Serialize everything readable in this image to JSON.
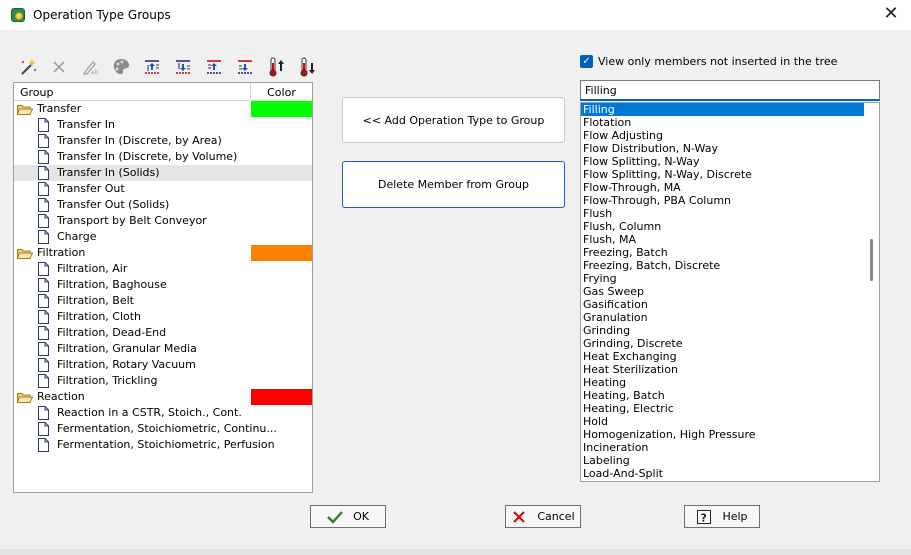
{
  "window": {
    "title": "Operation Type Groups",
    "close_glyph": "✕"
  },
  "toolbar": {
    "icons": [
      "magic-wand-icon",
      "delete-x-icon",
      "rename-pen-icon",
      "palette-icon",
      "move-up-icon",
      "move-down-icon",
      "move-up-alt-icon",
      "move-down-alt-icon",
      "thermo-up-icon",
      "thermo-down-icon"
    ]
  },
  "tree": {
    "header_group": "Group",
    "header_color": "Color",
    "groups": [
      {
        "label": "Transfer",
        "color": "#00ff00",
        "members": [
          "Transfer In",
          "Transfer In (Discrete, by Area)",
          "Transfer In (Discrete, by Volume)",
          "Transfer In (Solids)",
          "Transfer Out",
          "Transfer Out (Solids)",
          "Transport by Belt Conveyor",
          "Charge"
        ]
      },
      {
        "label": "Filtration",
        "color": "#ff8000",
        "members": [
          "Filtration, Air",
          "Filtration, Baghouse",
          "Filtration, Belt",
          "Filtration, Cloth",
          "Filtration, Dead-End",
          "Filtration, Granular Media",
          "Filtration, Rotary Vacuum",
          "Filtration, Trickling"
        ]
      },
      {
        "label": "Reaction",
        "color": "#ff0000",
        "members": [
          "Reaction in a CSTR, Stoich., Cont.",
          "Fermentation, Stoichiometric, Continu...",
          "Fermentation, Stoichiometric, Perfusion"
        ]
      }
    ],
    "selected_member": "Transfer In (Solids)"
  },
  "actions": {
    "add_label": "<< Add Operation Type to Group",
    "delete_label": "Delete  Member from Group"
  },
  "filter": {
    "checkbox_label": "View only members not inserted in the tree",
    "checked": true,
    "search_value": "Filling"
  },
  "list": {
    "items": [
      "Filling",
      "Flotation",
      "Flow Adjusting",
      "Flow Distribution, N-Way",
      "Flow Splitting, N-Way",
      "Flow Splitting, N-Way, Discrete",
      "Flow-Through, MA",
      "Flow-Through, PBA Column",
      "Flush",
      "Flush, Column",
      "Flush, MA",
      "Freezing, Batch",
      "Freezing, Batch, Discrete",
      "Frying",
      "Gas Sweep",
      "Gasification",
      "Granulation",
      "Grinding",
      "Grinding, Discrete",
      "Heat Exchanging",
      "Heat Sterilization",
      "Heating",
      "Heating, Batch",
      "Heating, Electric",
      "Hold",
      "Homogenization, High Pressure",
      "Incineration",
      "Labeling",
      "Load-And-Split"
    ],
    "selected": "Filling"
  },
  "buttons": {
    "ok_label": "OK",
    "cancel_label": "Cancel",
    "help_label": "Help"
  },
  "colors": {
    "accent": "#0078d7",
    "ok_check": "#2e7d32",
    "cancel_x": "#d01010"
  }
}
